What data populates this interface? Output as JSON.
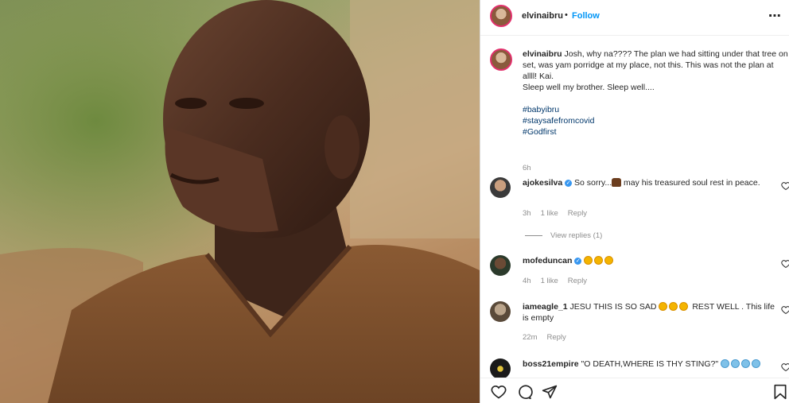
{
  "post": {
    "username": "elvinaibru",
    "follow_label": "Follow",
    "separator": "•",
    "more_icon": "more-icon"
  },
  "caption": {
    "username": "elvinaibru",
    "text": "Josh, why na???? The plan we had sitting under that tree on set, was yam porridge at my place, not this. This was not the plan at allll! Kai.",
    "line2": "Sleep well my brother. Sleep well....",
    "hashtags": [
      "#babyibru",
      "#staysafefromcovid",
      "#Godfirst"
    ],
    "time": "6h"
  },
  "comments": [
    {
      "username": "ajokesilva",
      "verified": true,
      "text_before": "So sorry...",
      "text_after": "may his treasured soul rest in peace.",
      "time": "3h",
      "likes": "1 like",
      "reply": "Reply"
    },
    {
      "username": "mofeduncan",
      "verified": true,
      "text": "",
      "time": "4h",
      "likes": "1 like",
      "reply": "Reply"
    },
    {
      "username": "iameagle_1",
      "verified": false,
      "text_before": "JESU THIS IS SO SAD",
      "text_after": "REST WELL . This life is empty",
      "time": "22m",
      "likes": "",
      "reply": "Reply"
    },
    {
      "username": "boss21empire",
      "verified": false,
      "text": "\"O DEATH,WHERE IS THY STING?\"",
      "time": "",
      "likes": "",
      "reply": ""
    }
  ],
  "view_replies": "View replies (1)",
  "actions": {
    "like": "heart-icon",
    "comment": "comment-icon",
    "share": "share-icon",
    "save": "bookmark-icon"
  },
  "colors": {
    "link_blue": "#0095f6",
    "hashtag": "#00376b",
    "meta_gray": "#8e8e8e"
  }
}
